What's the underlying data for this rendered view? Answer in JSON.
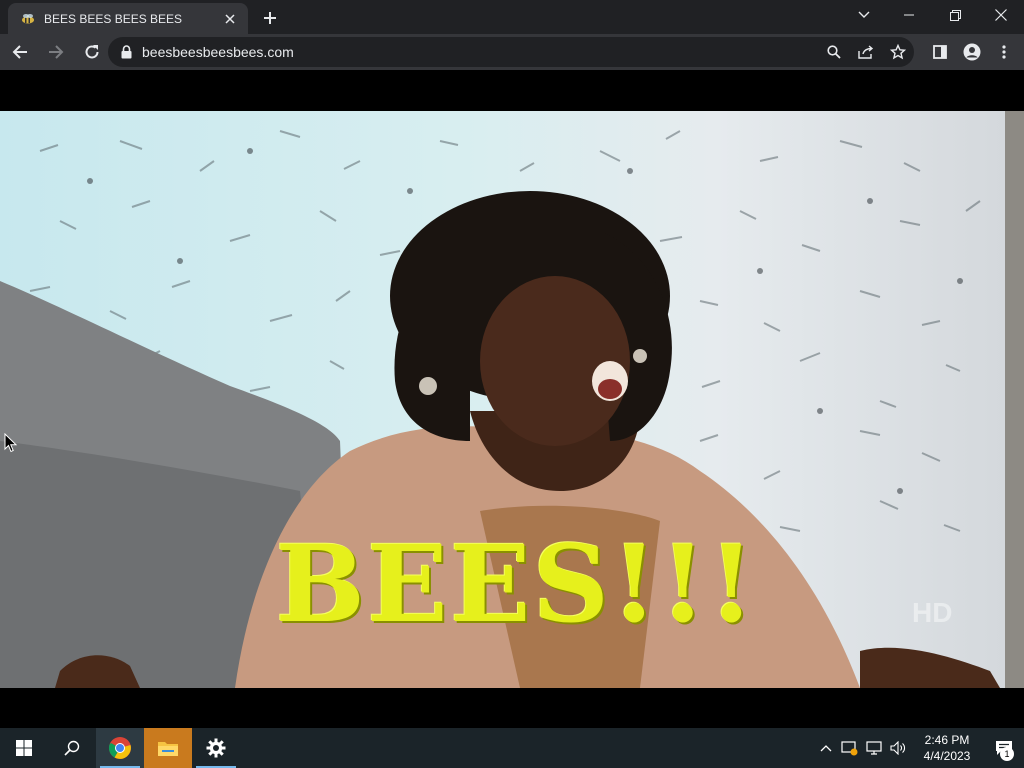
{
  "browser": {
    "tab": {
      "title": "BEES BEES BEES BEES"
    },
    "address_bar": {
      "url": "beesbeesbeesbees.com"
    }
  },
  "page": {
    "gif_caption": "BEES!!!",
    "watermark": "HD"
  },
  "taskbar": {
    "clock_time": "2:46 PM",
    "clock_date": "4/4/2023",
    "notification_count": "1"
  },
  "colors": {
    "titlebar": "#202124",
    "toolbar": "#35363a",
    "caption": "#e6f01c",
    "taskbar": "#1b2429"
  }
}
